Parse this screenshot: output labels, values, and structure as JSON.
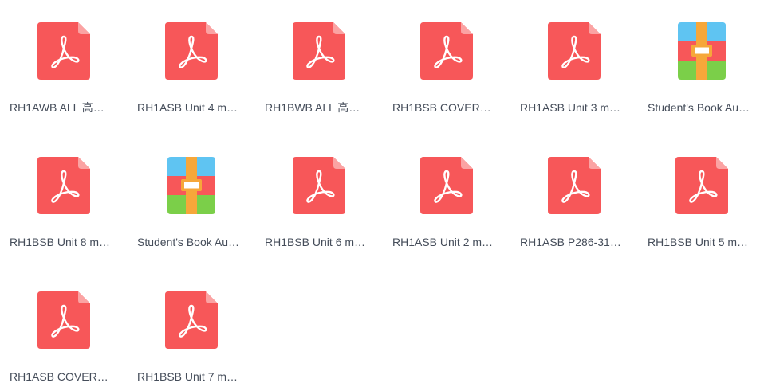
{
  "files": [
    {
      "name": "RH1AWB ALL 高…",
      "icon": "pdf-icon"
    },
    {
      "name": "RH1ASB Unit 4 m…",
      "icon": "pdf-icon"
    },
    {
      "name": "RH1BWB ALL 高…",
      "icon": "pdf-icon"
    },
    {
      "name": "RH1BSB COVER…",
      "icon": "pdf-icon"
    },
    {
      "name": "RH1ASB Unit 3 m…",
      "icon": "pdf-icon"
    },
    {
      "name": "Student's Book Au…",
      "icon": "archive-icon"
    },
    {
      "name": "RH1BSB Unit 8 m…",
      "icon": "pdf-icon"
    },
    {
      "name": "Student's Book Au…",
      "icon": "archive-icon"
    },
    {
      "name": "RH1BSB Unit 6 m…",
      "icon": "pdf-icon"
    },
    {
      "name": "RH1ASB Unit 2 m…",
      "icon": "pdf-icon"
    },
    {
      "name": "RH1ASB P286-31…",
      "icon": "pdf-icon"
    },
    {
      "name": "RH1BSB Unit 5 m…",
      "icon": "pdf-icon"
    },
    {
      "name": "RH1ASB COVER…",
      "icon": "pdf-icon"
    },
    {
      "name": "RH1BSB Unit 7 m…",
      "icon": "pdf-icon"
    }
  ],
  "colors": {
    "pdf_body": "#f75759",
    "pdf_fold": "#fba3a3",
    "pdf_glyph": "#ffffff",
    "archive_top": "#5fc4f2",
    "archive_middle": "#f75759",
    "archive_bottom": "#7bcf49",
    "archive_strap": "#f6a73a",
    "label_text": "#454d5a"
  }
}
